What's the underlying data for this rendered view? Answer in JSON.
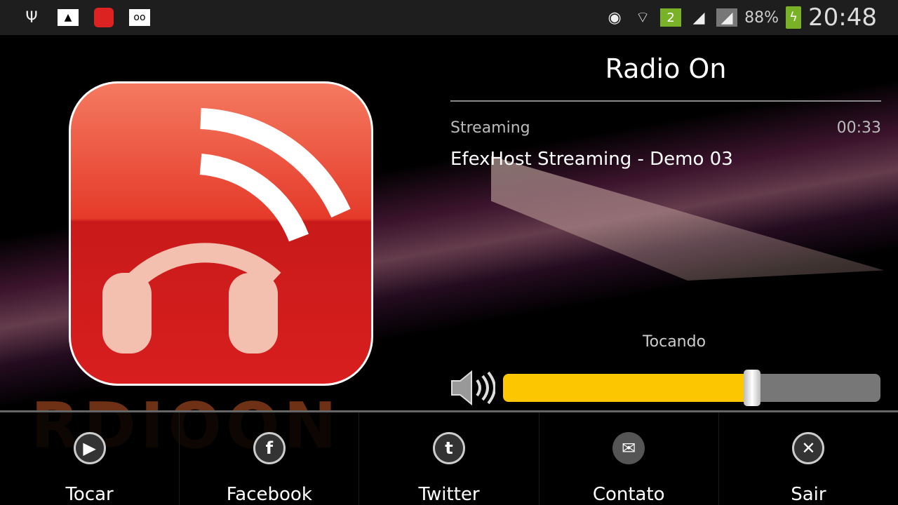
{
  "status_bar": {
    "time": "20:48",
    "battery": "88%",
    "sim_badge": "2",
    "left_icons": [
      "usb-icon",
      "gallery-icon",
      "rdioon-app-icon",
      "voicemail-icon"
    ],
    "right_icons": [
      "eye-icon",
      "wifi-icon",
      "sim-icon",
      "signal-icon",
      "signal-icon",
      "battery-charging-icon"
    ]
  },
  "logo": {
    "brand_text": "RDIOON",
    "colors": {
      "red": "#d81e1e",
      "light": "#f47a60"
    }
  },
  "player": {
    "title": "Radio On",
    "source_label": "Streaming",
    "elapsed": "00:33",
    "track": "EfexHost Streaming - Demo 03",
    "state": "Tocando",
    "volume_percent": 66,
    "accent": "#fcc600"
  },
  "bottom_bar": {
    "items": [
      {
        "label": "Tocar",
        "icon": "play-icon",
        "glyph": "▶"
      },
      {
        "label": "Facebook",
        "icon": "facebook-icon",
        "glyph": "f"
      },
      {
        "label": "Twitter",
        "icon": "twitter-icon",
        "glyph": "t"
      },
      {
        "label": "Contato",
        "icon": "mail-icon",
        "glyph": "✉"
      },
      {
        "label": "Sair",
        "icon": "close-icon",
        "glyph": "✕"
      }
    ]
  }
}
